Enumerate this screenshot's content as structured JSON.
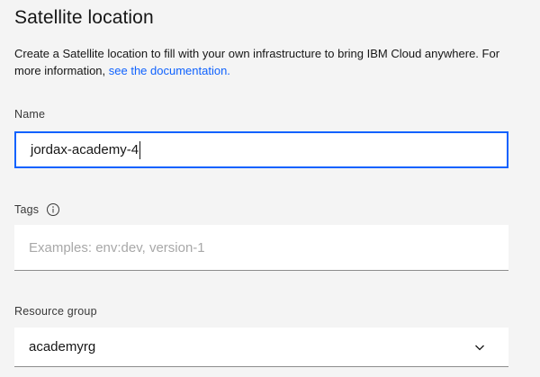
{
  "header": {
    "title": "Satellite location"
  },
  "description": {
    "text": "Create a Satellite location to fill with your own infrastructure to bring IBM Cloud anywhere. For more information, ",
    "link_text": "see the documentation."
  },
  "form": {
    "name": {
      "label": "Name",
      "value": "jordax-academy-4"
    },
    "tags": {
      "label": "Tags",
      "info_icon": "information-icon",
      "placeholder": "Examples: env:dev, version-1"
    },
    "resource_group": {
      "label": "Resource group",
      "selected": "academyrg",
      "icon": "chevron-down-icon"
    }
  },
  "colors": {
    "accent": "#0f62fe",
    "background": "#f4f4f4",
    "field_background": "#ffffff"
  }
}
